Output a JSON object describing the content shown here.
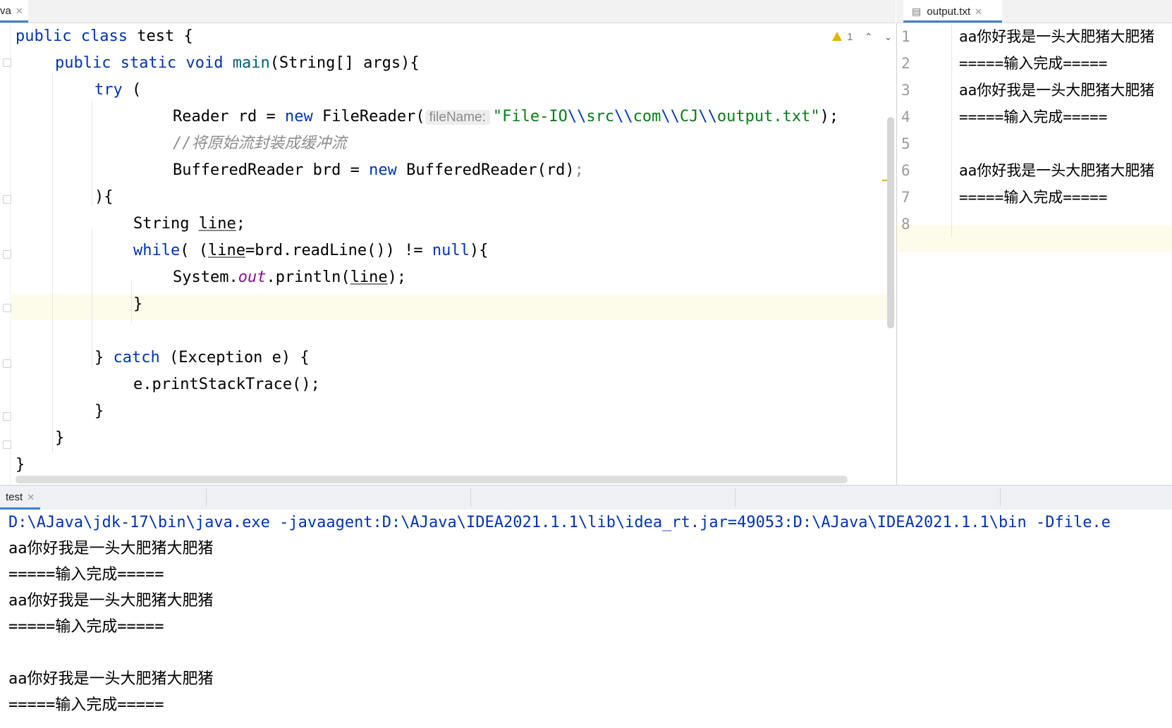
{
  "editor_tabs": {
    "left_tab_label": "va",
    "right_tab_label": "output.txt"
  },
  "warnings": {
    "count": "1"
  },
  "icons": {
    "warning": "warning-icon",
    "close": "close-icon",
    "prev": "chevron-up-icon",
    "next": "chevron-down-icon",
    "file": "file-icon"
  },
  "code": {
    "l1_kw1": "public",
    "l1_kw2": "class",
    "l1_name": "test {",
    "l2_kw1": "public",
    "l2_kw2": "static",
    "l2_kw3": "void",
    "l2_fn": "main",
    "l2_rest": "(String[] args){",
    "l3_kw": "try",
    "l3_rest": " (",
    "l4_a": "Reader rd = ",
    "l4_kw": "new",
    "l4_b": " FileReader(",
    "l4_hint": "fileName:",
    "l4_str1": "\"File-IO",
    "l4_esc1": "\\\\",
    "l4_str2": "src",
    "l4_esc2": "\\\\",
    "l4_str3": "com",
    "l4_esc3": "\\\\",
    "l4_str4": "CJ",
    "l4_esc4": "\\\\",
    "l4_str5": "output.txt\"",
    "l4_end": ");",
    "l5_comment": "//将原始流封装成缓冲流",
    "l6_a": "BufferedReader brd = ",
    "l6_kw": "new",
    "l6_b": " BufferedReader(rd)",
    "l6_semi": ";",
    "l7": "){",
    "l8_a": "String ",
    "l8_var": "line",
    "l8_b": ";",
    "l9_kw": "while",
    "l9_a": "( (",
    "l9_var": "line",
    "l9_b": "=brd.readLine()) != ",
    "l9_null": "null",
    "l9_c": "){",
    "l10_a": "System.",
    "l10_out": "out",
    "l10_b": ".println(",
    "l10_var": "line",
    "l10_c": ");",
    "l11": "}",
    "l13_a": "} ",
    "l13_kw": "catch",
    "l13_b": " (Exception e) {",
    "l14": "e.printStackTrace();",
    "l15": "}",
    "l16": "}",
    "l17": "}"
  },
  "output_file": {
    "line_numbers": [
      "1",
      "2",
      "3",
      "4",
      "5",
      "6",
      "7",
      "8"
    ],
    "lines": [
      "aa你好我是一头大肥猪大肥猪",
      "=====输入完成=====",
      "aa你好我是一头大肥猪大肥猪",
      "=====输入完成=====",
      "",
      "aa你好我是一头大肥猪大肥猪",
      "=====输入完成=====",
      ""
    ]
  },
  "console": {
    "tab_label": "test",
    "command": "D:\\AJava\\jdk-17\\bin\\java.exe -javaagent:D:\\AJava\\IDEA2021.1.1\\lib\\idea_rt.jar=49053:D:\\AJava\\IDEA2021.1.1\\bin -Dfile.e",
    "lines": [
      "aa你好我是一头大肥猪大肥猪",
      "=====输入完成=====",
      "aa你好我是一头大肥猪大肥猪",
      "=====输入完成=====",
      "",
      "aa你好我是一头大肥猪大肥猪",
      "=====输入完成====="
    ]
  }
}
